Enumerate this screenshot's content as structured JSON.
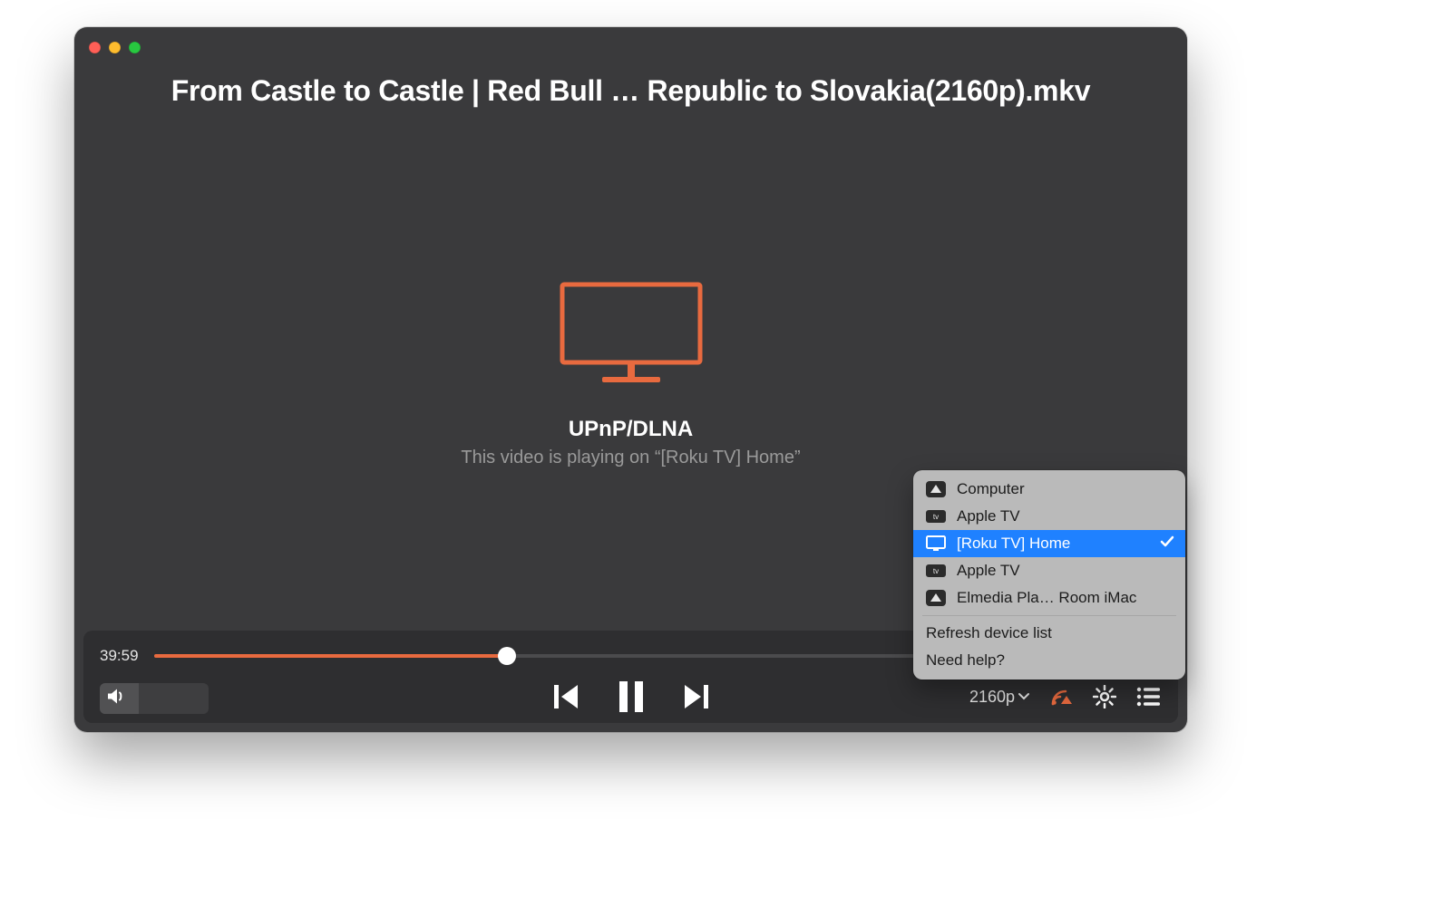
{
  "title": "From Castle to Castle | Red Bull … Republic to Slovakia(2160p).mkv",
  "cast": {
    "protocol": "UPnP/DLNA",
    "status": "This video is playing on “[Roku TV] Home”"
  },
  "player": {
    "elapsed": "39:59",
    "progress_pct": 35,
    "quality": "2160p"
  },
  "menu": {
    "items": [
      {
        "label": "Computer",
        "icon": "computer",
        "selected": false
      },
      {
        "label": "Apple TV",
        "icon": "appletv",
        "selected": false
      },
      {
        "label": "[Roku TV] Home",
        "icon": "tv",
        "selected": true
      },
      {
        "label": "Apple TV",
        "icon": "appletv",
        "selected": false
      },
      {
        "label": "Elmedia Pla… Room iMac",
        "icon": "computer",
        "selected": false
      }
    ],
    "refresh": "Refresh device list",
    "help": "Need help?"
  },
  "colors": {
    "accent": "#e86a3f",
    "select": "#1f81ff"
  }
}
